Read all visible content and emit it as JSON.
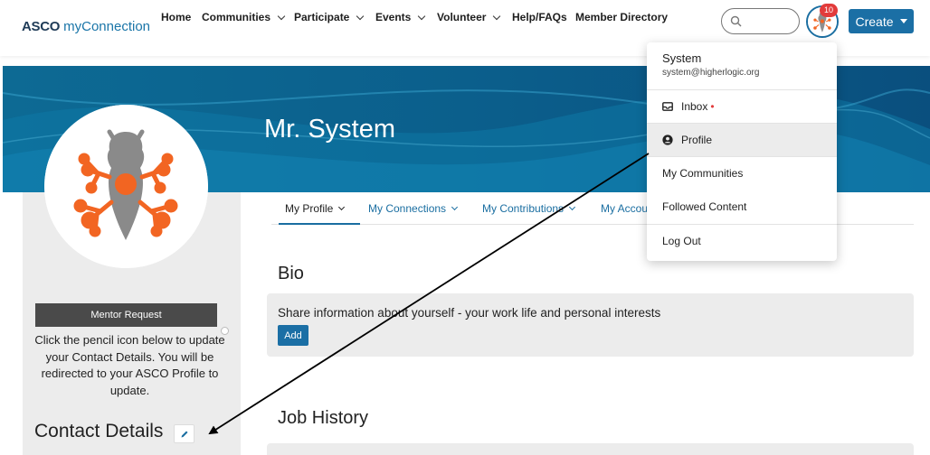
{
  "logo": {
    "part1": "ASCO",
    "part2": "myConnection"
  },
  "nav": {
    "items": [
      {
        "label": "Home",
        "has_caret": false
      },
      {
        "label": "Communities",
        "has_caret": true
      },
      {
        "label": "Participate",
        "has_caret": true
      },
      {
        "label": "Events",
        "has_caret": true
      },
      {
        "label": "Volunteer",
        "has_caret": true
      },
      {
        "label": "Help/FAQs",
        "has_caret": false
      },
      {
        "label": "Member Directory",
        "has_caret": false
      }
    ],
    "notification_count": "10",
    "create_label": "Create"
  },
  "profile": {
    "name": "Mr. System"
  },
  "tabs": [
    {
      "label": "My Profile",
      "active": true
    },
    {
      "label": "My Connections",
      "active": false
    },
    {
      "label": "My Contributions",
      "active": false
    },
    {
      "label": "My Accou",
      "active": false
    }
  ],
  "left": {
    "mentor_label": "Mentor Request",
    "message": "Click the pencil icon below to update your Contact Details. You will be redirected to your ASCO Profile to update.",
    "contact_title": "Contact Details"
  },
  "bio": {
    "title": "Bio",
    "text": "Share information about yourself - your work life and personal interests",
    "add_label": "Add"
  },
  "job": {
    "title": "Job History"
  },
  "dropdown": {
    "user_name": "System",
    "user_email": "system@higherlogic.org",
    "items": [
      {
        "label": "Inbox",
        "icon": "inbox-icon",
        "unread_dot": "•"
      },
      {
        "label": "Profile",
        "icon": "user-circle-icon"
      },
      {
        "label": "My Communities"
      },
      {
        "label": "Followed Content"
      },
      {
        "label": "Log Out"
      }
    ]
  },
  "colors": {
    "brand_blue": "#1b6fa5",
    "logo_orange": "#f26522",
    "banner_dark": "#0a5a85",
    "badge_red": "#e23b3b"
  }
}
